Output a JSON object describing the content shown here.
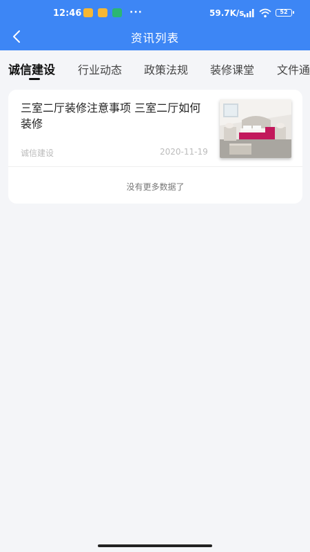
{
  "status_bar": {
    "time": "12:46",
    "dots": "···",
    "network_speed": "59.7K/s",
    "battery": "52",
    "app_icon_colors": [
      "#f7b733",
      "#f7b733",
      "#2bb673"
    ]
  },
  "header": {
    "title": "资讯列表",
    "back_icon": "chevron-left-icon",
    "background": "#3d86f5"
  },
  "tabs": [
    {
      "label": "诚信建设",
      "active": true
    },
    {
      "label": "行业动态",
      "active": false
    },
    {
      "label": "政策法规",
      "active": false
    },
    {
      "label": "装修课堂",
      "active": false
    },
    {
      "label": "文件通",
      "active": false
    }
  ],
  "news": {
    "items": [
      {
        "title": "三室二厅装修注意事项 三室二厅如何装修",
        "category": "诚信建设",
        "date": "2020-11-19",
        "thumbnail": "bedroom-photo"
      }
    ],
    "no_more": "没有更多数据了"
  }
}
